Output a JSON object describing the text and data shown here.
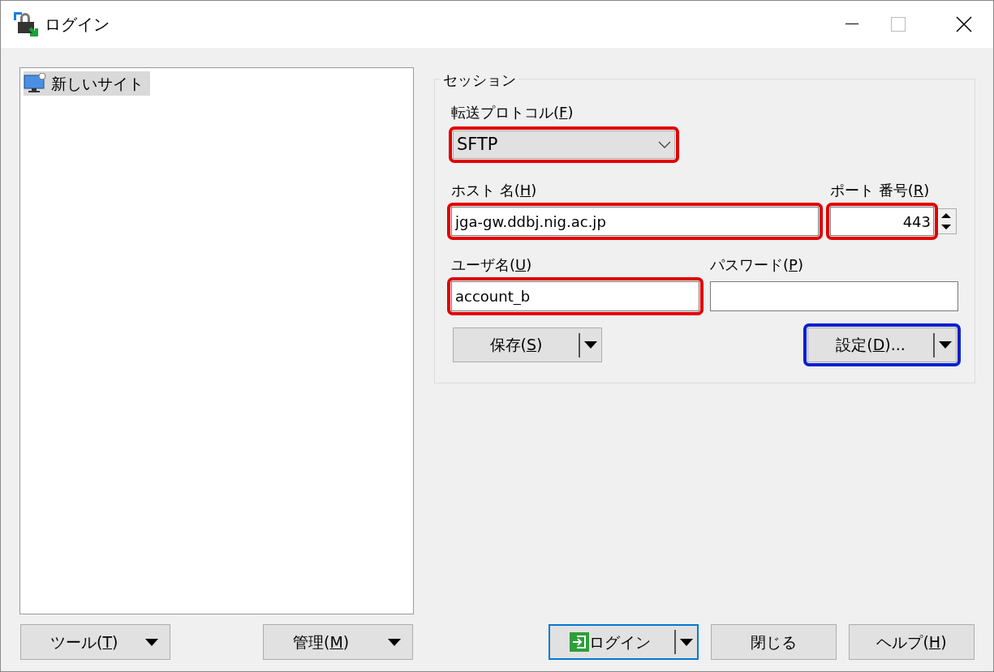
{
  "window": {
    "title": "ログイン"
  },
  "sites": [
    {
      "label": "新しいサイト",
      "selected": true
    }
  ],
  "session": {
    "title": "セッション",
    "protocol": {
      "label": [
        "転送プロトコル(",
        "F",
        ")"
      ],
      "value": "SFTP",
      "color": "#e00000"
    },
    "host": {
      "label": [
        "ホスト 名(",
        "H",
        ")"
      ],
      "value": "jga-gw.ddbj.nig.ac.jp",
      "color": "#e00000"
    },
    "port": {
      "label": [
        "ポート 番号(",
        "R",
        ")"
      ],
      "value": "443",
      "color": "#e00000"
    },
    "user": {
      "label": [
        "ユーザ名(",
        "U",
        ")"
      ],
      "value": "account_b",
      "color": "#e00000"
    },
    "password": {
      "label": [
        "パスワード(",
        "P",
        ")"
      ]
    },
    "save_button": {
      "label": [
        "保存(",
        "S",
        ")"
      ]
    },
    "advanced_button": {
      "label": [
        "設定(",
        "D",
        ")..."
      ],
      "color": "#0020d0"
    }
  },
  "bottom_left_buttons": [
    {
      "label": [
        "ツール(",
        "T",
        ")"
      ]
    },
    {
      "label": [
        "管理(",
        "M",
        ")"
      ]
    }
  ],
  "bottom_right_buttons": [
    {
      "kind": "split",
      "label": [
        "ログイン"
      ],
      "default": true
    },
    {
      "kind": "plain",
      "label": [
        "閉じる"
      ],
      "default": false
    },
    {
      "kind": "plain",
      "label": [
        "ヘルプ(",
        "H",
        ")"
      ],
      "default": false
    }
  ]
}
